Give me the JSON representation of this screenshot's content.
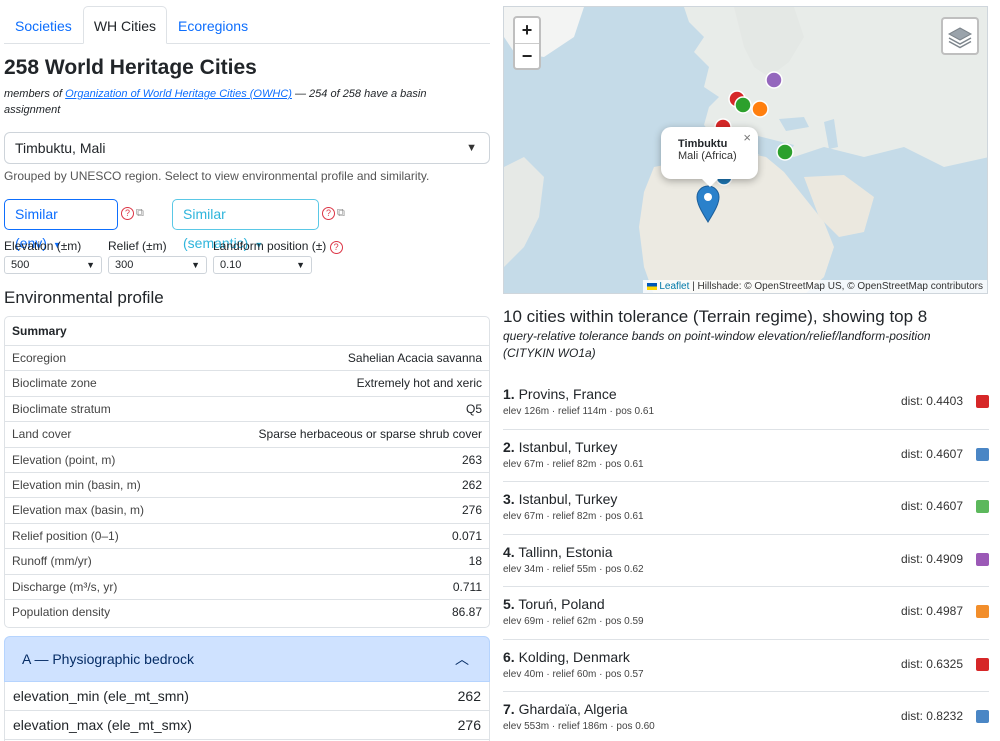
{
  "tabs": [
    {
      "label": "Societies",
      "active": false
    },
    {
      "label": "WH Cities",
      "active": true
    },
    {
      "label": "Ecoregions",
      "active": false
    }
  ],
  "title": "258 World Heritage Cities",
  "subtitle": {
    "prefix": "members of ",
    "link": "Organization of World Heritage Cities (OWHC)",
    "suffix": " — 254 of 258 have a basin assignment"
  },
  "city_select": {
    "value": "Timbuktu, Mali"
  },
  "hint": "Grouped by UNESCO region. Select to view environmental profile and similarity.",
  "buttons": {
    "similar_env": "Similar (env)",
    "similar_semantic": "Similar (semantic)"
  },
  "controls": {
    "elevation": {
      "label": "Elevation (±m)",
      "value": "500"
    },
    "relief": {
      "label": "Relief (±m)",
      "value": "300"
    },
    "landform": {
      "label": "Landform position (±)",
      "value": "0.10"
    }
  },
  "env_heading": "Environmental profile",
  "summary": {
    "heading": "Summary",
    "rows": [
      {
        "k": "Ecoregion",
        "v": "Sahelian Acacia savanna"
      },
      {
        "k": "Bioclimate zone",
        "v": "Extremely hot and xeric"
      },
      {
        "k": "Bioclimate stratum",
        "v": "Q5"
      },
      {
        "k": "Land cover",
        "v": "Sparse herbaceous or sparse shrub cover"
      },
      {
        "k": "Elevation (point, m)",
        "v": "263"
      },
      {
        "k": "Elevation min (basin, m)",
        "v": "262"
      },
      {
        "k": "Elevation max (basin, m)",
        "v": "276"
      },
      {
        "k": "Relief position (0–1)",
        "v": "0.071"
      },
      {
        "k": "Runoff (mm/yr)",
        "v": "18"
      },
      {
        "k": "Discharge (m³/s, yr)",
        "v": "0.711"
      },
      {
        "k": "Population density",
        "v": "86.87"
      }
    ]
  },
  "accordion": {
    "title": "A — Physiographic bedrock",
    "rows": [
      {
        "k": "elevation_min (ele_mt_smn)",
        "v": "262"
      },
      {
        "k": "elevation_max (ele_mt_smx)",
        "v": "276"
      }
    ]
  },
  "map": {
    "zoom_in": "+",
    "zoom_out": "−",
    "popup_title": "Timbuktu",
    "popup_sub": "Mali (Africa)",
    "popup_close": "×",
    "attr_leaflet": "Leaflet",
    "attr_rest": " | Hillshade: © OpenStreetMap US, © OpenStreetMap contributors",
    "marker_colors": [
      "#d62728",
      "#1f77b4",
      "#2ca02c",
      "#9467bd",
      "#ff7f0e"
    ],
    "pin_color": "#2a81cb"
  },
  "results": {
    "title": "10 cities within tolerance (Terrain regime), showing top 8",
    "subtitle": "query-relative tolerance bands on point-window elevation/relief/landform-position (CITYKIN WO1a)",
    "items": [
      {
        "rank": "1.",
        "name": "Provins, France",
        "meta": "elev 126m · relief 114m · pos 0.61",
        "dist": "dist: 0.4403",
        "color": "#d62728"
      },
      {
        "rank": "2.",
        "name": "Istanbul, Turkey",
        "meta": "elev 67m · relief 82m · pos 0.61",
        "dist": "dist: 0.4607",
        "color": "#4a86c5"
      },
      {
        "rank": "3.",
        "name": "Istanbul, Turkey",
        "meta": "elev 67m · relief 82m · pos 0.61",
        "dist": "dist: 0.4607",
        "color": "#5cb85c"
      },
      {
        "rank": "4.",
        "name": "Tallinn, Estonia",
        "meta": "elev 34m · relief 55m · pos 0.62",
        "dist": "dist: 0.4909",
        "color": "#9b59b6"
      },
      {
        "rank": "5.",
        "name": "Toruń, Poland",
        "meta": "elev 69m · relief 62m · pos 0.59",
        "dist": "dist: 0.4987",
        "color": "#f28e2b"
      },
      {
        "rank": "6.",
        "name": "Kolding, Denmark",
        "meta": "elev 40m · relief 60m · pos 0.57",
        "dist": "dist: 0.6325",
        "color": "#d62728"
      },
      {
        "rank": "7.",
        "name": "Ghardaïa, Algeria",
        "meta": "elev 553m · relief 186m · pos 0.60",
        "dist": "dist: 0.8232",
        "color": "#4a86c5"
      }
    ]
  }
}
